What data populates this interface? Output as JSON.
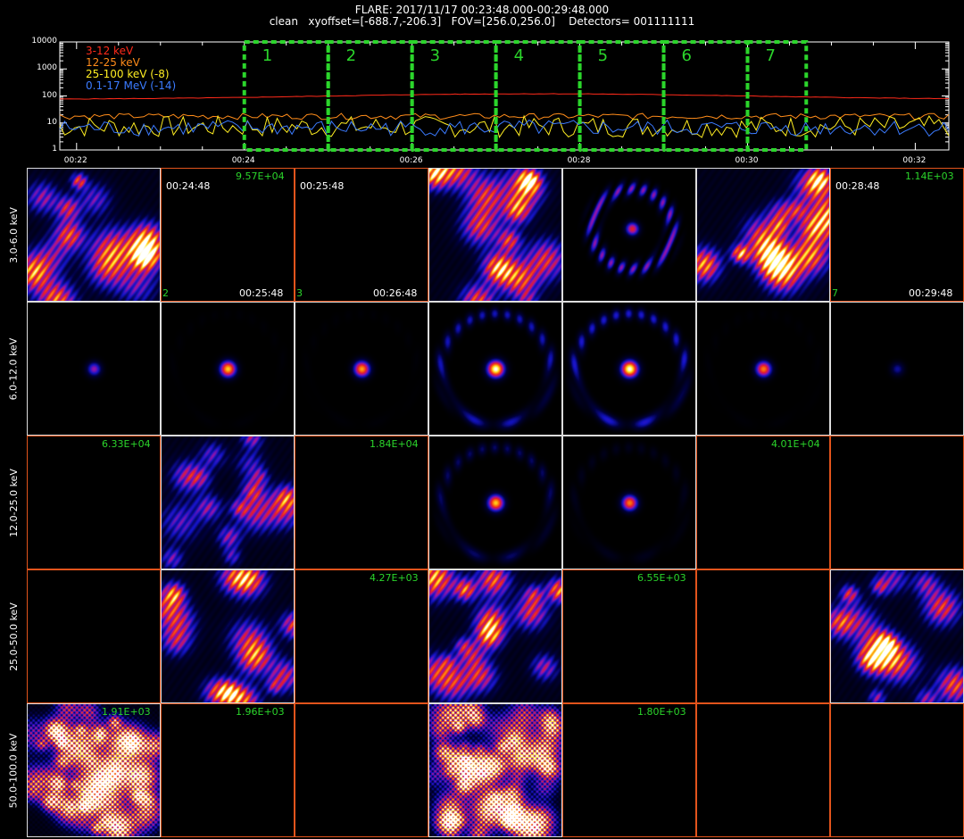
{
  "header": {
    "line1": "FLARE: 2017/11/17 00:23:48.000-00:29:48.000",
    "line2": "clean   xyoffset=[-688.7,-206.3]   FOV=[256.0,256.0]    Detectors= 001111111"
  },
  "chart_data": {
    "type": "line",
    "title": "",
    "y_scale": "log",
    "yticks": [
      "10000",
      "1000",
      "100",
      "10",
      "1"
    ],
    "xticks": [
      "00:22",
      "00:24",
      "00:26",
      "00:28",
      "00:30",
      "00:32"
    ],
    "xrange_min": [
      21.8,
      32.4
    ],
    "series": [
      {
        "name": "3-12 keV",
        "color": "#ff2a1a",
        "level": 75,
        "level_peak": 120
      },
      {
        "name": "12-25 keV",
        "color": "#ff8c1a",
        "level": 18
      },
      {
        "name": "25-100 keV (-8)",
        "color": "#ffee22",
        "level": 8
      },
      {
        "name": "0.1-17 MeV (-14)",
        "color": "#3b7bff",
        "level": 7
      }
    ],
    "intervals": [
      "1",
      "2",
      "3",
      "4",
      "5",
      "6",
      "7"
    ],
    "interval_bounds_min": [
      [
        24.0,
        25.0
      ],
      [
        25.0,
        26.0
      ],
      [
        26.0,
        27.0
      ],
      [
        27.0,
        28.0
      ],
      [
        28.0,
        29.0
      ],
      [
        29.0,
        30.0
      ],
      [
        30.0,
        30.7
      ]
    ]
  },
  "image_grid": {
    "energy_bands": [
      "3.0-6.0 keV",
      "6.0-12.0 keV",
      "12.0-25.0 keV",
      "25.0-50.0 keV",
      "50.0-100.0 keV"
    ],
    "rows": [
      {
        "texts": [
          {
            "col": 1,
            "pos": "tr",
            "text": "9.57E+04",
            "c": "g"
          },
          {
            "col": 1,
            "pos": "tl",
            "text": "00:24:48",
            "c": "w"
          },
          {
            "col": 1,
            "pos": "bl",
            "text": "2",
            "c": "g"
          },
          {
            "col": 1,
            "pos": "br",
            "text": "00:25:48",
            "c": "w"
          },
          {
            "col": 2,
            "pos": "tl",
            "text": "00:25:48",
            "c": "w"
          },
          {
            "col": 2,
            "pos": "bl",
            "text": "3",
            "c": "g"
          },
          {
            "col": 2,
            "pos": "br",
            "text": "00:26:48",
            "c": "w"
          },
          {
            "col": 6,
            "pos": "tr",
            "text": "1.14E+03",
            "c": "g"
          },
          {
            "col": 6,
            "pos": "tl",
            "text": "00:28:48",
            "c": "w"
          },
          {
            "col": 6,
            "pos": "bl",
            "text": "7",
            "c": "g"
          },
          {
            "col": 6,
            "pos": "br",
            "text": "00:29:48",
            "c": "w"
          }
        ],
        "cells": [
          {
            "type": "noise",
            "seed": 3,
            "density": 0.55,
            "frame": "w"
          },
          {
            "type": "blank",
            "frame": "o"
          },
          {
            "type": "blank",
            "frame": "o"
          },
          {
            "type": "noise",
            "seed": 11,
            "density": 0.7,
            "frame": "w"
          },
          {
            "type": "ring",
            "seed": 12,
            "intensity": 0.8,
            "ring": 0.8,
            "frame": "w"
          },
          {
            "type": "noise",
            "seed": 17,
            "density": 0.65,
            "frame": "w"
          },
          {
            "type": "blank",
            "frame": "o"
          }
        ]
      },
      {
        "texts": [],
        "cells": [
          {
            "type": "source",
            "intensity": 0.45,
            "ring": 0,
            "frame": "w"
          },
          {
            "type": "source",
            "intensity": 0.85,
            "ring": 0.05,
            "frame": "w"
          },
          {
            "type": "source",
            "intensity": 0.8,
            "ring": 0.05,
            "frame": "w"
          },
          {
            "type": "source",
            "intensity": 1.0,
            "ring": 0.9,
            "frame": "w"
          },
          {
            "type": "source",
            "intensity": 1.0,
            "ring": 1.0,
            "frame": "w"
          },
          {
            "type": "source",
            "intensity": 0.75,
            "ring": 0.05,
            "frame": "w"
          },
          {
            "type": "source",
            "intensity": 0.25,
            "ring": 0,
            "frame": "w"
          }
        ]
      },
      {
        "texts": [
          {
            "col": 0,
            "pos": "tr",
            "text": "6.33E+04",
            "c": "g"
          },
          {
            "col": 2,
            "pos": "tr",
            "text": "1.84E+04",
            "c": "g"
          },
          {
            "col": 5,
            "pos": "tr",
            "text": "4.01E+04",
            "c": "g"
          }
        ],
        "cells": [
          {
            "type": "blank",
            "frame": "o"
          },
          {
            "type": "speckle",
            "seed": 21,
            "density": 0.3,
            "frame": "w"
          },
          {
            "type": "blank",
            "frame": "o"
          },
          {
            "type": "source",
            "intensity": 0.85,
            "ring": 0.6,
            "frame": "w"
          },
          {
            "type": "source",
            "intensity": 0.75,
            "ring": 0.2,
            "frame": "w"
          },
          {
            "type": "blank",
            "frame": "o"
          },
          {
            "type": "blank",
            "frame": "o"
          }
        ]
      },
      {
        "texts": [
          {
            "col": 2,
            "pos": "tr",
            "text": "4.27E+03",
            "c": "g"
          },
          {
            "col": 4,
            "pos": "tr",
            "text": "6.55E+03",
            "c": "g"
          }
        ],
        "cells": [
          {
            "type": "blank",
            "frame": "o"
          },
          {
            "type": "speckle",
            "seed": 31,
            "density": 0.5,
            "frame": "w"
          },
          {
            "type": "blank",
            "frame": "o"
          },
          {
            "type": "speckle",
            "seed": 33,
            "density": 0.5,
            "frame": "w"
          },
          {
            "type": "blank",
            "frame": "o"
          },
          {
            "type": "blank",
            "frame": "o"
          },
          {
            "type": "speckle",
            "seed": 37,
            "density": 0.45,
            "frame": "w"
          }
        ]
      },
      {
        "texts": [
          {
            "col": 0,
            "pos": "tr",
            "text": "1.91E+03",
            "c": "g"
          },
          {
            "col": 1,
            "pos": "tr",
            "text": "1.96E+03",
            "c": "g"
          },
          {
            "col": 4,
            "pos": "tr",
            "text": "1.80E+03",
            "c": "g"
          }
        ],
        "cells": [
          {
            "type": "fine",
            "seed": 41,
            "density": 0.6,
            "frame": "w"
          },
          {
            "type": "blank",
            "frame": "o"
          },
          {
            "type": "blank",
            "frame": "o"
          },
          {
            "type": "fine",
            "seed": 43,
            "density": 0.6,
            "frame": "w"
          },
          {
            "type": "blank",
            "frame": "o"
          },
          {
            "type": "blank",
            "frame": "o"
          },
          {
            "type": "blank",
            "frame": "o"
          }
        ]
      }
    ]
  }
}
